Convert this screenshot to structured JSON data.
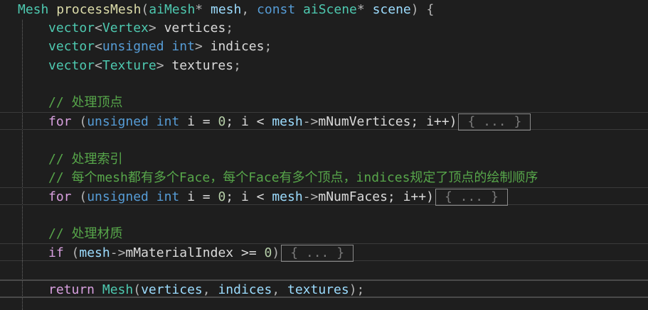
{
  "code": {
    "l1": {
      "ret_type": "Mesh",
      "fn_name": "processMesh",
      "p1": "(",
      "param_type1": "aiMesh",
      "star1": "*",
      "param1": " mesh",
      "comma": ", ",
      "const_kw": "const",
      "param_type2": " aiScene",
      "star2": "*",
      "param2": " scene",
      "close": ") {"
    },
    "l2": {
      "t1": "vector",
      "lt": "<",
      "t2": "Vertex",
      "gt": ">",
      "name": " vertices",
      "semi": ";"
    },
    "l3": {
      "t1": "vector",
      "lt": "<",
      "k1": "unsigned",
      "k2": " int",
      "gt": ">",
      "name": " indices",
      "semi": ";"
    },
    "l4": {
      "t1": "vector",
      "lt": "<",
      "t2": "Texture",
      "gt": ">",
      "name": " textures",
      "semi": ";"
    },
    "c1": "// 处理顶点",
    "for1": {
      "kw": "for",
      "open": " (",
      "k1": "unsigned",
      "k2": " int",
      "rest1": " i = ",
      "zero": "0",
      "rest2": "; i < ",
      "mesh": "mesh",
      "arrow": "->",
      "member": "mNumVertices",
      "rest3": "; i++)"
    },
    "c2": "// 处理索引",
    "c3": "// 每个mesh都有多个Face，每个Face有多个顶点，indices规定了顶点的绘制顺序",
    "for2": {
      "kw": "for",
      "open": " (",
      "k1": "unsigned",
      "k2": " int",
      "rest1": " i = ",
      "zero": "0",
      "rest2": "; i < ",
      "mesh": "mesh",
      "arrow": "->",
      "member": "mNumFaces",
      "rest3": "; i++)"
    },
    "c4": "// 处理材质",
    "if1": {
      "kw": "if",
      "open": " (",
      "mesh": "mesh",
      "arrow": "->",
      "member": "mMaterialIndex",
      "rest1": " >= ",
      "zero": "0",
      "close": ")"
    },
    "ret": {
      "kw": "return",
      "type": " Mesh",
      "open": "(",
      "a1": "vertices",
      "comma1": ", ",
      "a2": "indices",
      "comma2": ", ",
      "a3": "textures",
      "close": ");"
    },
    "fold_label": "{ ... }"
  },
  "colors": {
    "background": "#1e1e1e",
    "keyword": "#569cd6",
    "control_keyword": "#d8a0df",
    "type": "#4ec9b0",
    "variable": "#9cdcfe",
    "function": "#dcdcaa",
    "comment": "#57a64a",
    "number": "#b5cea8"
  }
}
